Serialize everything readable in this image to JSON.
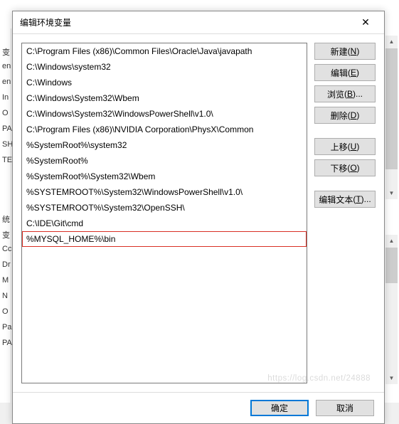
{
  "dialog": {
    "title": "编辑环境变量",
    "close_label": "✕"
  },
  "path_entries": [
    "C:\\Program Files (x86)\\Common Files\\Oracle\\Java\\javapath",
    "C:\\Windows\\system32",
    "C:\\Windows",
    "C:\\Windows\\System32\\Wbem",
    "C:\\Windows\\System32\\WindowsPowerShell\\v1.0\\",
    "C:\\Program Files (x86)\\NVIDIA Corporation\\PhysX\\Common",
    "%SystemRoot%\\system32",
    "%SystemRoot%",
    "%SystemRoot%\\System32\\Wbem",
    "%SYSTEMROOT%\\System32\\WindowsPowerShell\\v1.0\\",
    "%SYSTEMROOT%\\System32\\OpenSSH\\",
    "C:\\IDE\\Git\\cmd",
    "%MYSQL_HOME%\\bin"
  ],
  "highlighted_index": 12,
  "buttons": {
    "new": {
      "label": "新建",
      "key": "N"
    },
    "edit": {
      "label": "编辑",
      "key": "E"
    },
    "browse": {
      "label": "浏览",
      "key": "B",
      "suffix": "..."
    },
    "delete": {
      "label": "删除",
      "key": "D"
    },
    "moveup": {
      "label": "上移",
      "key": "U"
    },
    "movedown": {
      "label": "下移",
      "key": "O"
    },
    "edittext": {
      "label": "编辑文本",
      "key": "T",
      "suffix": "..."
    }
  },
  "footer": {
    "ok": "确定",
    "cancel": "取消"
  },
  "bg": {
    "labels_top": [
      "变",
      "en",
      "en",
      "In",
      "O",
      "PA",
      "SH",
      "TE"
    ],
    "labels_bot": [
      "统",
      "变",
      "Cc",
      "Dr",
      "M",
      "N",
      "O",
      "Pa",
      "PA"
    ]
  },
  "watermark": "https://log.csdn.net/24888"
}
